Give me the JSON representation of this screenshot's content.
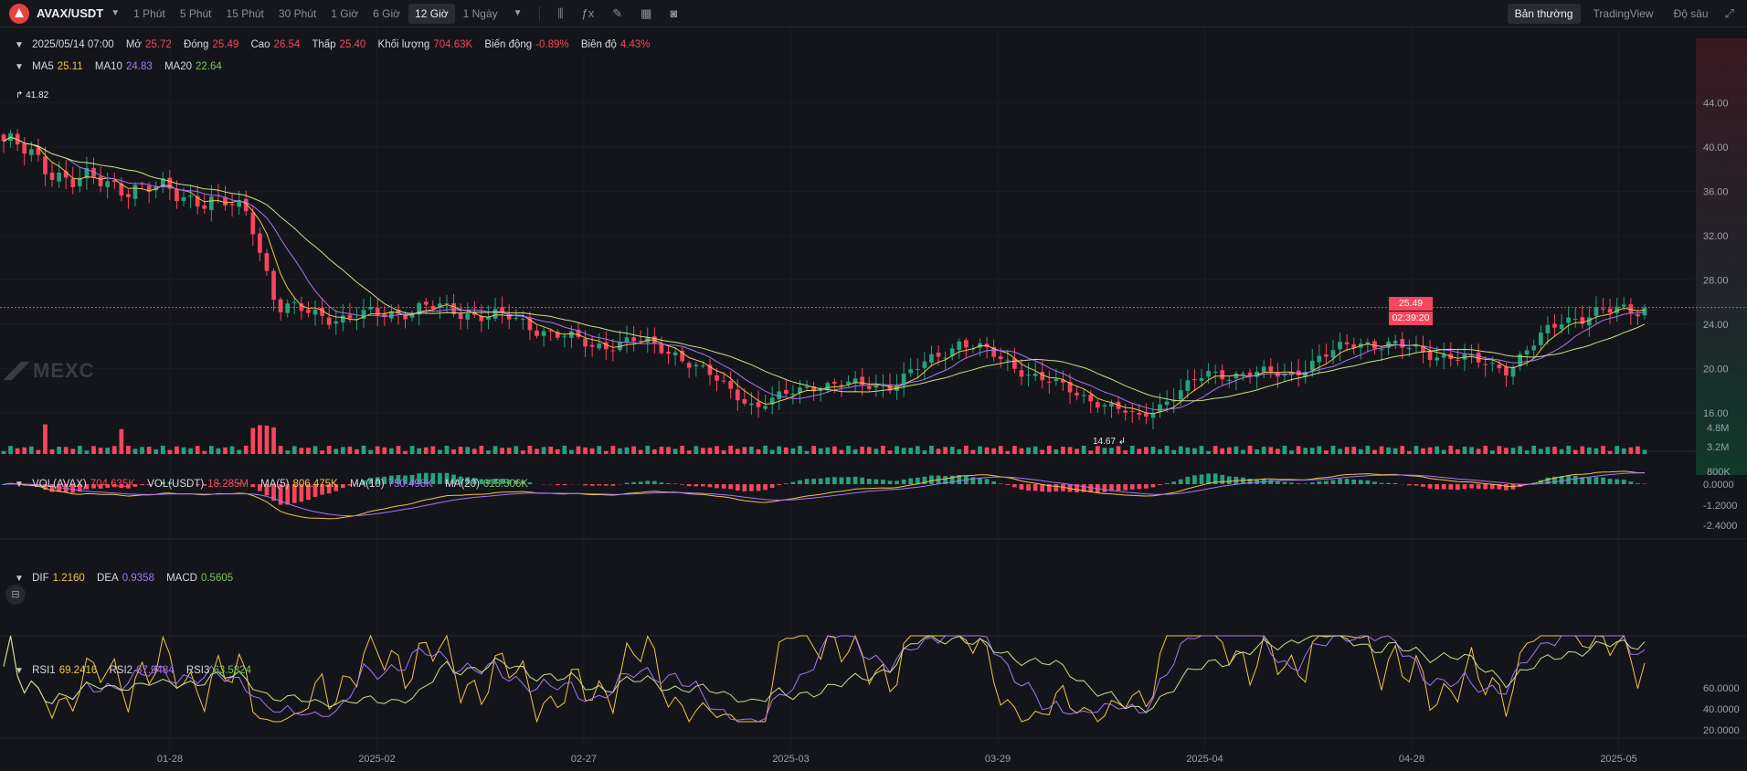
{
  "toolbar": {
    "symbol": "AVAX/USDT",
    "timeframes": [
      "1 Phút",
      "5 Phút",
      "15 Phút",
      "30 Phút",
      "1 Giờ",
      "6 Giờ",
      "12 Giờ",
      "1 Ngày"
    ],
    "active_timeframe": "12 Giờ",
    "tools": [
      "candle-type-icon",
      "indicator-icon",
      "draw-icon",
      "layout-icon",
      "camera-icon"
    ],
    "view_tabs": [
      "Bản thường",
      "TradingView",
      "Độ sâu"
    ],
    "active_view": "Bản thường"
  },
  "ohlc": {
    "date": "2025/05/14 07:00",
    "open_label": "Mở",
    "open": "25.72",
    "close_label": "Đóng",
    "close": "25.49",
    "high_label": "Cao",
    "high": "26.54",
    "low_label": "Thấp",
    "low": "25.40",
    "volume_label": "Khối lượng",
    "volume": "704.63K",
    "change_label": "Biến động",
    "change": "-0.89%",
    "amplitude_label": "Biên độ",
    "amplitude": "4.43%"
  },
  "ma": {
    "ma5_label": "MA5",
    "ma5": "25.11",
    "ma10_label": "MA10",
    "ma10": "24.83",
    "ma20_label": "MA20",
    "ma20": "22.64"
  },
  "volume": {
    "vol_avax_label": "VOL(AVAX)",
    "vol_avax": "704.635K",
    "vol_usdt_label": "VOL(USDT)",
    "vol_usdt": "18.285M",
    "ma5_label": "MA(5)",
    "ma5": "806.475K",
    "ma10_label": "MA(10)",
    "ma10": "750.498K",
    "ma20_label": "MA(20)",
    "ma20": "613.506K",
    "axis": [
      "4.8M",
      "3.2M",
      "800K"
    ]
  },
  "macd": {
    "dif_label": "DIF",
    "dif": "1.2160",
    "dea_label": "DEA",
    "dea": "0.9358",
    "macd_label": "MACD",
    "macd": "0.5605",
    "axis": [
      "0.0000",
      "-1.2000",
      "-2.4000"
    ]
  },
  "rsi": {
    "rsi1_label": "RSI1",
    "rsi1": "69.2416",
    "rsi2_label": "RSI2",
    "rsi2": "67.9484",
    "rsi3_label": "RSI3",
    "rsi3": "63.5824",
    "axis": [
      "60.0000",
      "40.0000",
      "20.0000"
    ]
  },
  "price_axis": [
    "44.00",
    "40.00",
    "36.00",
    "32.00",
    "28.00",
    "24.00",
    "20.00",
    "16.00"
  ],
  "last_price": "25.49",
  "countdown": "02:39:20",
  "high_marker": "41.82",
  "low_marker": "14.67",
  "date_axis": [
    "01-28",
    "2025-02",
    "02-27",
    "2025-03",
    "03-29",
    "2025-04",
    "04-28",
    "2025-05"
  ],
  "watermark": "MEXC",
  "colors": {
    "up": "#26a17b",
    "down": "#f6465d",
    "ma5": "#f0c44a",
    "ma10": "#a675f5",
    "ma20": "#c9e08a",
    "bg": "#14151a"
  },
  "chart_data": {
    "type": "candlestick",
    "symbol": "AVAX/USDT",
    "interval": "12h",
    "price_range": [
      14.0,
      46.0
    ],
    "key_prices": {
      "max_high": 41.82,
      "min_low": 14.67,
      "last_close": 25.49
    },
    "close_path": [
      {
        "x": "2025-01-14",
        "y": 40.5
      },
      {
        "x": "2025-01-19",
        "y": 37.0
      },
      {
        "x": "2025-01-23",
        "y": 36.5
      },
      {
        "x": "2025-01-28",
        "y": 35.5
      },
      {
        "x": "2025-02-01",
        "y": 34.0
      },
      {
        "x": "2025-02-03",
        "y": 25.5
      },
      {
        "x": "2025-02-08",
        "y": 24.5
      },
      {
        "x": "2025-02-14",
        "y": 25.5
      },
      {
        "x": "2025-02-20",
        "y": 24.5
      },
      {
        "x": "2025-02-26",
        "y": 22.0
      },
      {
        "x": "2025-03-01",
        "y": 22.5
      },
      {
        "x": "2025-03-04",
        "y": 21.5
      },
      {
        "x": "2025-03-10",
        "y": 16.5
      },
      {
        "x": "2025-03-14",
        "y": 18.5
      },
      {
        "x": "2025-03-20",
        "y": 18.5
      },
      {
        "x": "2025-03-25",
        "y": 22.5
      },
      {
        "x": "2025-03-31",
        "y": 19.0
      },
      {
        "x": "2025-04-07",
        "y": 15.5
      },
      {
        "x": "2025-04-12",
        "y": 19.5
      },
      {
        "x": "2025-04-18",
        "y": 19.5
      },
      {
        "x": "2025-04-23",
        "y": 22.5
      },
      {
        "x": "2025-04-28",
        "y": 21.5
      },
      {
        "x": "2025-05-04",
        "y": 20.0
      },
      {
        "x": "2025-05-08",
        "y": 24.5
      },
      {
        "x": "2025-05-14",
        "y": 25.49
      }
    ]
  }
}
